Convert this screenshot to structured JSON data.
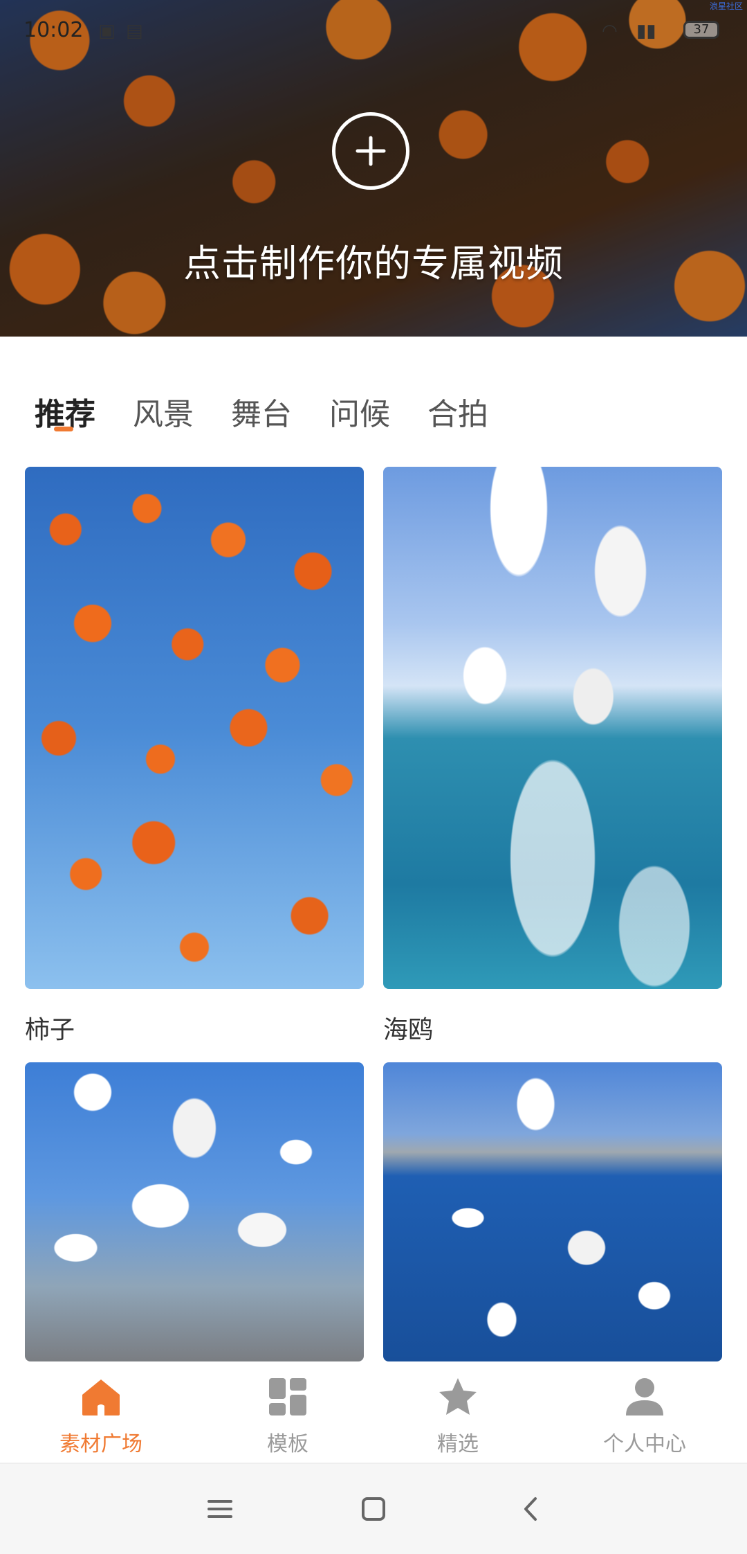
{
  "status_bar": {
    "time": "10:02",
    "battery": "37",
    "corner_text": "浪星社区"
  },
  "hero": {
    "cta_text": "点击制作你的专属视频",
    "add_icon": "plus-circle-icon"
  },
  "tabs": [
    {
      "label": "推荐",
      "active": true
    },
    {
      "label": "风景",
      "active": false
    },
    {
      "label": "舞台",
      "active": false
    },
    {
      "label": "问候",
      "active": false
    },
    {
      "label": "合拍",
      "active": false
    }
  ],
  "cards": [
    {
      "title": "柿子"
    },
    {
      "title": "海鸥"
    },
    {
      "title": ""
    },
    {
      "title": ""
    }
  ],
  "bottom_nav": [
    {
      "label": "素材广场",
      "icon": "home-icon",
      "active": true
    },
    {
      "label": "模板",
      "icon": "grid-icon",
      "active": false
    },
    {
      "label": "精选",
      "icon": "star-icon",
      "active": false
    },
    {
      "label": "个人中心",
      "icon": "person-icon",
      "active": false
    }
  ],
  "colors": {
    "accent": "#f07a32",
    "nav_inactive": "#9a9a9a"
  }
}
